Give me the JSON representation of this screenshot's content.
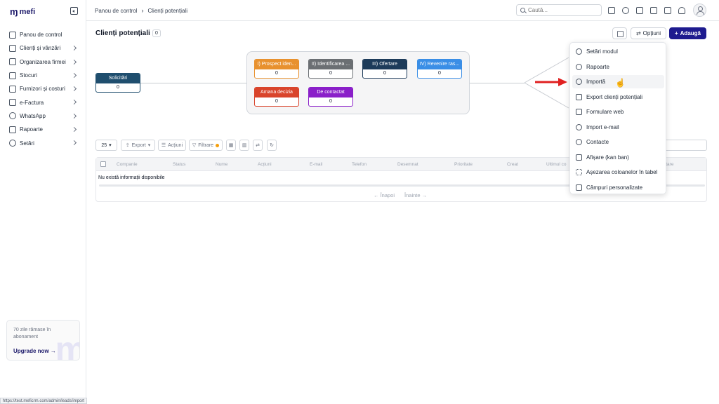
{
  "sidebar": {
    "logo": "mefi",
    "items": [
      {
        "label": "Panou de control",
        "icon": "home-icon",
        "chevron": false
      },
      {
        "label": "Clienți și vânzări",
        "icon": "users-icon",
        "chevron": true
      },
      {
        "label": "Organizarea firmei",
        "icon": "org-icon",
        "chevron": true
      },
      {
        "label": "Stocuri",
        "icon": "box-icon",
        "chevron": true
      },
      {
        "label": "Furnizori și costuri",
        "icon": "wallet-icon",
        "chevron": true
      },
      {
        "label": "e-Factura",
        "icon": "invoice-icon",
        "chevron": true
      },
      {
        "label": "WhatsApp",
        "icon": "whatsapp-icon",
        "chevron": true
      },
      {
        "label": "Rapoarte",
        "icon": "clipboard-icon",
        "chevron": true
      },
      {
        "label": "Setări",
        "icon": "gear-icon",
        "chevron": true
      }
    ],
    "upgrade": {
      "text": "70 zile rămase în abonament",
      "link": "Upgrade now"
    }
  },
  "status_url": "https://test.meficrm.com/admin/leads/import",
  "topbar": {
    "breadcrumb": [
      "Panou de control",
      "Clienți potențiali"
    ],
    "search_placeholder": "Caută..."
  },
  "main": {
    "title": "Clienți potențiali",
    "count": "0",
    "options_label": "Opțiuni",
    "add_label": "Adaugă"
  },
  "pipeline": {
    "source": {
      "label": "Solicitări",
      "count": "0",
      "color": "#1f4e6e"
    },
    "stages": [
      {
        "label": "I) Prospect iden...",
        "count": "0",
        "color": "#e8912e"
      },
      {
        "label": "II) Identificarea ...",
        "count": "0",
        "color": "#6b6f73"
      },
      {
        "label": "III) Ofertare",
        "count": "0",
        "color": "#1d3b5a"
      },
      {
        "label": "IV) Revenire ras...",
        "count": "0",
        "color": "#3a8ee6"
      },
      {
        "label": "Amana decizia",
        "count": "0",
        "color": "#d9442b"
      },
      {
        "label": "De contactat",
        "count": "0",
        "color": "#8a1fc9"
      }
    ]
  },
  "toolbar": {
    "page_size": "25",
    "export": "Export",
    "actions": "Acțiuni",
    "filter": "Filtrare"
  },
  "table": {
    "columns": [
      "Companie",
      "Status",
      "Nume",
      "Acțiuni",
      "E-mail",
      "Telefon",
      "Desemnat",
      "Prioritate",
      "Creat",
      "Ultimul co",
      "ctare"
    ],
    "empty_text": "Nu există informații disponibile",
    "prev": "← Înapoi",
    "next": "Înainte →"
  },
  "dropdown": {
    "items": [
      "Setări modul",
      "Rapoarte",
      "Importă",
      "Export clienți potențiali",
      "Formulare web",
      "Import e-mail",
      "Contacte",
      "Afișare (kan ban)",
      "Așezarea coloanelor în tabel",
      "Câmpuri personalizate"
    ],
    "active_index": 2
  },
  "colors": {
    "accent": "#1e1b8f",
    "annotation_arrow": "#e02020"
  }
}
